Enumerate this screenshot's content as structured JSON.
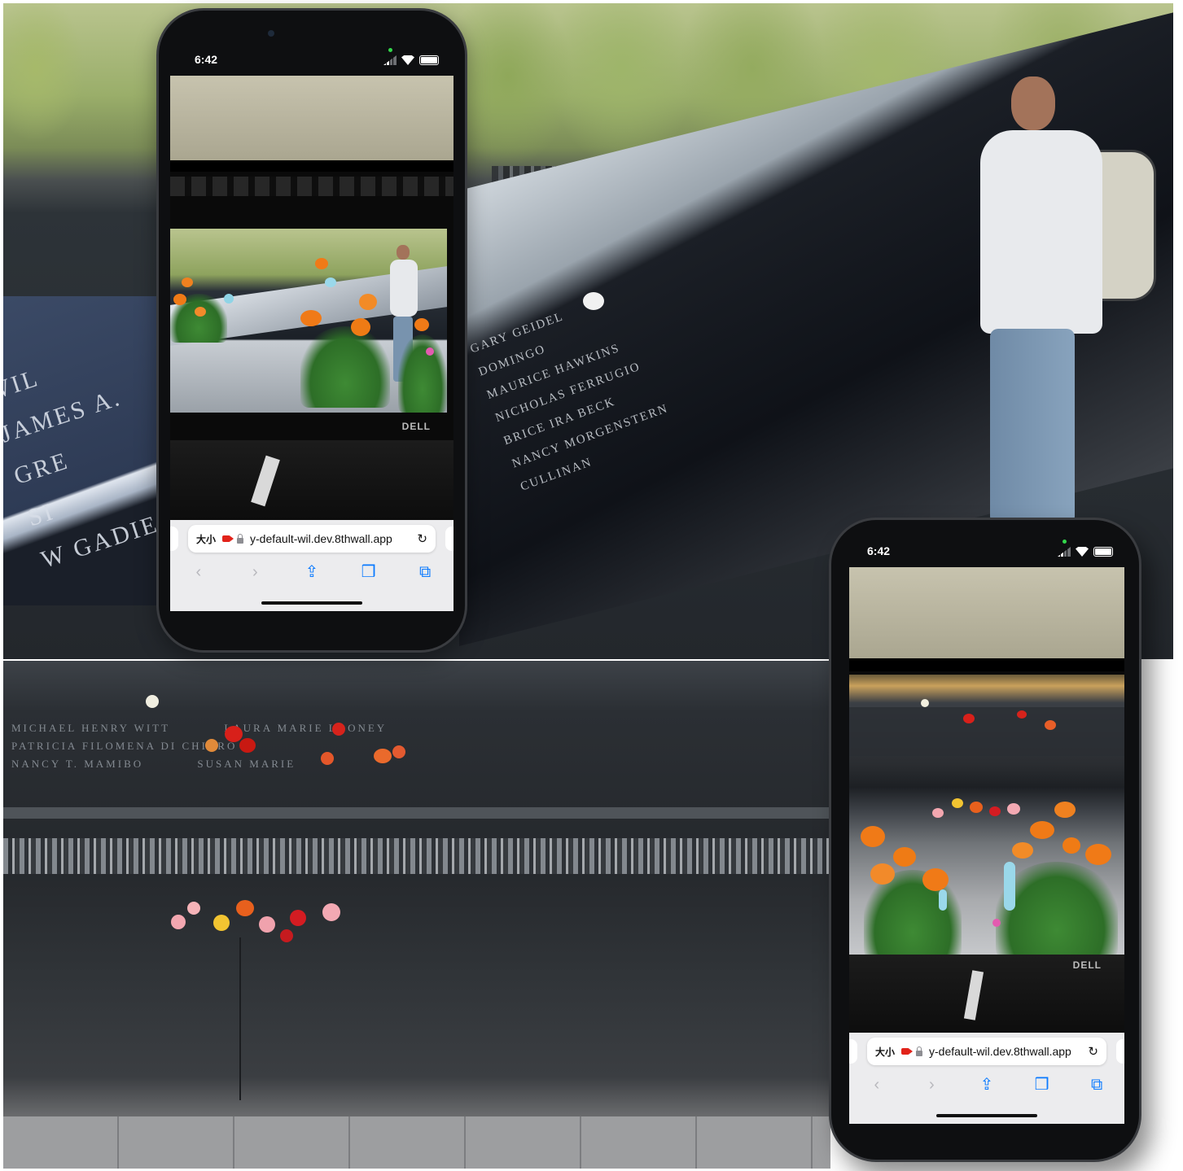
{
  "phones": [
    {
      "status_time": "6:42",
      "url_left_label": "大小",
      "url": "y-default-wil.dev.8thwall.app",
      "monitor_brand": "DELL"
    },
    {
      "status_time": "6:42",
      "url_left_label": "大小",
      "url": "y-default-wil.dev.8thwall.app",
      "monitor_brand": "DELL"
    }
  ],
  "memorial_names_left": [
    "WIL",
    "JAMES A.",
    "GRE",
    "SI",
    "W GADIE"
  ],
  "memorial_names_top": [
    "GARY GEIDEL",
    "DOMINGO",
    "MAURICE HAWKINS",
    "NICHOLAS FERRUGIO",
    "BRICE IRA BECK",
    "NANCY MORGENSTERN",
    "CULLINAN"
  ],
  "memorial_names_bottom": [
    "MICHAEL HENRY WITT",
    "LAURA MARIE LOONEY",
    "PATRICIA FILOMENA DI CHIARO",
    "NANCY T. MAMIBO",
    "SUSAN MARIE"
  ],
  "browser_toolbar_icons": [
    "back-icon",
    "forward-icon",
    "share-icon",
    "bookmarks-icon",
    "tabs-icon"
  ],
  "colors": {
    "ios_blue": "#0a7aff",
    "recording_red": "#e2231a",
    "ar_orange": "#f07a17"
  }
}
